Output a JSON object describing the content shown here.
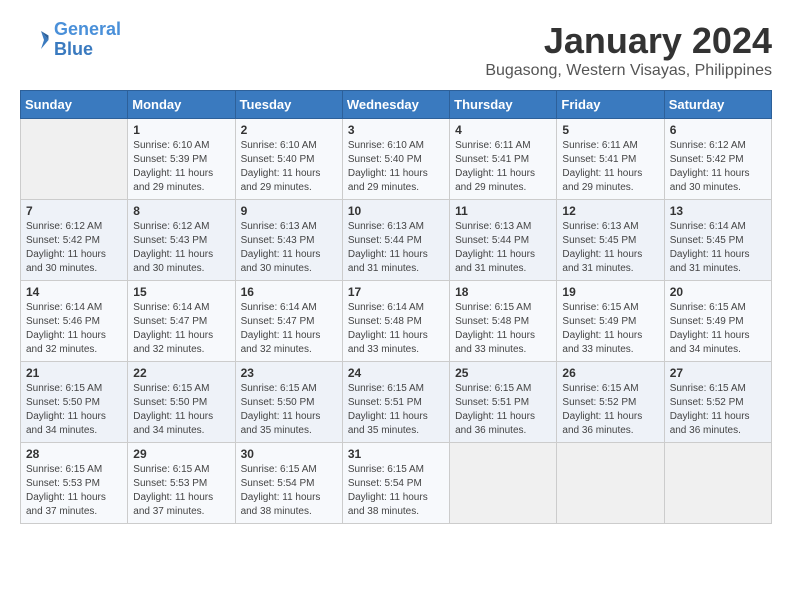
{
  "logo": {
    "line1": "General",
    "line2": "Blue"
  },
  "title": "January 2024",
  "subtitle": "Bugasong, Western Visayas, Philippines",
  "weekdays": [
    "Sunday",
    "Monday",
    "Tuesday",
    "Wednesday",
    "Thursday",
    "Friday",
    "Saturday"
  ],
  "weeks": [
    [
      {
        "num": "",
        "sunrise": "",
        "sunset": "",
        "daylight": ""
      },
      {
        "num": "1",
        "sunrise": "Sunrise: 6:10 AM",
        "sunset": "Sunset: 5:39 PM",
        "daylight": "Daylight: 11 hours and 29 minutes."
      },
      {
        "num": "2",
        "sunrise": "Sunrise: 6:10 AM",
        "sunset": "Sunset: 5:40 PM",
        "daylight": "Daylight: 11 hours and 29 minutes."
      },
      {
        "num": "3",
        "sunrise": "Sunrise: 6:10 AM",
        "sunset": "Sunset: 5:40 PM",
        "daylight": "Daylight: 11 hours and 29 minutes."
      },
      {
        "num": "4",
        "sunrise": "Sunrise: 6:11 AM",
        "sunset": "Sunset: 5:41 PM",
        "daylight": "Daylight: 11 hours and 29 minutes."
      },
      {
        "num": "5",
        "sunrise": "Sunrise: 6:11 AM",
        "sunset": "Sunset: 5:41 PM",
        "daylight": "Daylight: 11 hours and 29 minutes."
      },
      {
        "num": "6",
        "sunrise": "Sunrise: 6:12 AM",
        "sunset": "Sunset: 5:42 PM",
        "daylight": "Daylight: 11 hours and 30 minutes."
      }
    ],
    [
      {
        "num": "7",
        "sunrise": "Sunrise: 6:12 AM",
        "sunset": "Sunset: 5:42 PM",
        "daylight": "Daylight: 11 hours and 30 minutes."
      },
      {
        "num": "8",
        "sunrise": "Sunrise: 6:12 AM",
        "sunset": "Sunset: 5:43 PM",
        "daylight": "Daylight: 11 hours and 30 minutes."
      },
      {
        "num": "9",
        "sunrise": "Sunrise: 6:13 AM",
        "sunset": "Sunset: 5:43 PM",
        "daylight": "Daylight: 11 hours and 30 minutes."
      },
      {
        "num": "10",
        "sunrise": "Sunrise: 6:13 AM",
        "sunset": "Sunset: 5:44 PM",
        "daylight": "Daylight: 11 hours and 31 minutes."
      },
      {
        "num": "11",
        "sunrise": "Sunrise: 6:13 AM",
        "sunset": "Sunset: 5:44 PM",
        "daylight": "Daylight: 11 hours and 31 minutes."
      },
      {
        "num": "12",
        "sunrise": "Sunrise: 6:13 AM",
        "sunset": "Sunset: 5:45 PM",
        "daylight": "Daylight: 11 hours and 31 minutes."
      },
      {
        "num": "13",
        "sunrise": "Sunrise: 6:14 AM",
        "sunset": "Sunset: 5:45 PM",
        "daylight": "Daylight: 11 hours and 31 minutes."
      }
    ],
    [
      {
        "num": "14",
        "sunrise": "Sunrise: 6:14 AM",
        "sunset": "Sunset: 5:46 PM",
        "daylight": "Daylight: 11 hours and 32 minutes."
      },
      {
        "num": "15",
        "sunrise": "Sunrise: 6:14 AM",
        "sunset": "Sunset: 5:47 PM",
        "daylight": "Daylight: 11 hours and 32 minutes."
      },
      {
        "num": "16",
        "sunrise": "Sunrise: 6:14 AM",
        "sunset": "Sunset: 5:47 PM",
        "daylight": "Daylight: 11 hours and 32 minutes."
      },
      {
        "num": "17",
        "sunrise": "Sunrise: 6:14 AM",
        "sunset": "Sunset: 5:48 PM",
        "daylight": "Daylight: 11 hours and 33 minutes."
      },
      {
        "num": "18",
        "sunrise": "Sunrise: 6:15 AM",
        "sunset": "Sunset: 5:48 PM",
        "daylight": "Daylight: 11 hours and 33 minutes."
      },
      {
        "num": "19",
        "sunrise": "Sunrise: 6:15 AM",
        "sunset": "Sunset: 5:49 PM",
        "daylight": "Daylight: 11 hours and 33 minutes."
      },
      {
        "num": "20",
        "sunrise": "Sunrise: 6:15 AM",
        "sunset": "Sunset: 5:49 PM",
        "daylight": "Daylight: 11 hours and 34 minutes."
      }
    ],
    [
      {
        "num": "21",
        "sunrise": "Sunrise: 6:15 AM",
        "sunset": "Sunset: 5:50 PM",
        "daylight": "Daylight: 11 hours and 34 minutes."
      },
      {
        "num": "22",
        "sunrise": "Sunrise: 6:15 AM",
        "sunset": "Sunset: 5:50 PM",
        "daylight": "Daylight: 11 hours and 34 minutes."
      },
      {
        "num": "23",
        "sunrise": "Sunrise: 6:15 AM",
        "sunset": "Sunset: 5:50 PM",
        "daylight": "Daylight: 11 hours and 35 minutes."
      },
      {
        "num": "24",
        "sunrise": "Sunrise: 6:15 AM",
        "sunset": "Sunset: 5:51 PM",
        "daylight": "Daylight: 11 hours and 35 minutes."
      },
      {
        "num": "25",
        "sunrise": "Sunrise: 6:15 AM",
        "sunset": "Sunset: 5:51 PM",
        "daylight": "Daylight: 11 hours and 36 minutes."
      },
      {
        "num": "26",
        "sunrise": "Sunrise: 6:15 AM",
        "sunset": "Sunset: 5:52 PM",
        "daylight": "Daylight: 11 hours and 36 minutes."
      },
      {
        "num": "27",
        "sunrise": "Sunrise: 6:15 AM",
        "sunset": "Sunset: 5:52 PM",
        "daylight": "Daylight: 11 hours and 36 minutes."
      }
    ],
    [
      {
        "num": "28",
        "sunrise": "Sunrise: 6:15 AM",
        "sunset": "Sunset: 5:53 PM",
        "daylight": "Daylight: 11 hours and 37 minutes."
      },
      {
        "num": "29",
        "sunrise": "Sunrise: 6:15 AM",
        "sunset": "Sunset: 5:53 PM",
        "daylight": "Daylight: 11 hours and 37 minutes."
      },
      {
        "num": "30",
        "sunrise": "Sunrise: 6:15 AM",
        "sunset": "Sunset: 5:54 PM",
        "daylight": "Daylight: 11 hours and 38 minutes."
      },
      {
        "num": "31",
        "sunrise": "Sunrise: 6:15 AM",
        "sunset": "Sunset: 5:54 PM",
        "daylight": "Daylight: 11 hours and 38 minutes."
      },
      {
        "num": "",
        "sunrise": "",
        "sunset": "",
        "daylight": ""
      },
      {
        "num": "",
        "sunrise": "",
        "sunset": "",
        "daylight": ""
      },
      {
        "num": "",
        "sunrise": "",
        "sunset": "",
        "daylight": ""
      }
    ]
  ]
}
